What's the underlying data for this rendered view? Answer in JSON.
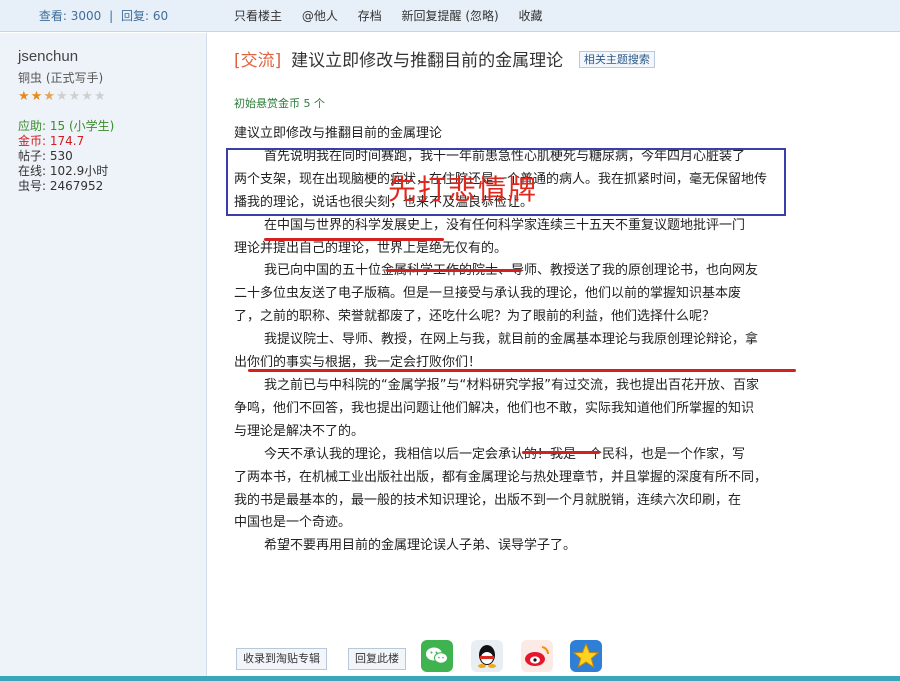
{
  "topbar": {
    "views": "查看: 3000",
    "sep": "|",
    "replies": "回复: 60",
    "actions": [
      "只看楼主",
      "@他人",
      "存档",
      "新回复提醒 (忽略)",
      "收藏"
    ]
  },
  "sidebar": {
    "username": "jsenchun",
    "rank": "铜虫 (正式写手)",
    "stars": "★★★☆☆☆☆",
    "stats": [
      "应助: 15 (小学生)",
      "金币: 174.7",
      "帖子: 530",
      "在线: 102.9小时",
      "虫号: 2467952"
    ]
  },
  "post": {
    "tag": "[交流]",
    "title": "建议立即修改与推翻目前的金属理论",
    "related": "相关主题搜索",
    "bounty": "初始悬赏金币 5 个",
    "lines": [
      "建议立即修改与推翻目前的金属理论",
      "首先说明我在同时间赛跑，我十一年前患急性心肌梗死与糖尿病，今年四月心脏装了",
      "两个支架，现在出现脑梗的症状，在住院还是一个普通的病人。我在抓紧时间，毫无保留地传",
      "播我的理论，说话也很尖刻，也来不及温良恭俭让。",
      "在中国与世界的科学发展史上，没有任何科学家连续三十五天不重复议题地批评一门",
      "理论并提出自己的理论，世界上是绝无仅有的。",
      "我已向中国的五十位金属科学工作的院士、导师、教授送了我的原创理论书，也向网友",
      "二十多位虫友送了电子版稿。但是一旦接受与承认我的理论，他们以前的掌握知识基本废",
      "了，之前的职称、荣誉就都废了，还吃什么呢？为了眼前的利益，他们选择什么呢？",
      "我提议院士、导师、教授，在网上与我，就目前的金属基本理论与我原创理论辩论，拿",
      "出你们的事实与根据，我一定会打败你们！",
      "我之前已与中科院的“金属学报”与“材料研究学报”有过交流，我也提出百花开放、百家",
      "争鸣，他们不回答，我也提出问题让他们解决，他们也不敢，实际我知道他们所掌握的知识",
      "与理论是解决不了的。",
      "今天不承认我的理论，我相信以后一定会承认的！我是一个民科，也是一个作家，写",
      "了两本书，在机械工业出版社出版，都有金属理论与热处理章节，并且掌握的深度有所不同，",
      "我的书是最基本的，最一般的技术知识理论，出版不到一个月就脱销，连续六次印刷，在",
      "中国也是一个奇迹。",
      "希望不要再用目前的金属理论误人子弟、误导学子了。"
    ],
    "overlay": "先打悲情牌",
    "buttons": {
      "collect": "收录到淘贴专辑",
      "reply": "回复此楼"
    },
    "share": [
      "wechat-icon",
      "qq-icon",
      "weibo-icon",
      "star-icon"
    ]
  },
  "colors": {
    "tag": "#e0623f",
    "annotation_box": "#3a3ea8",
    "annotation_red": "#d52020",
    "bottom_strip": "#3aa6b9"
  }
}
